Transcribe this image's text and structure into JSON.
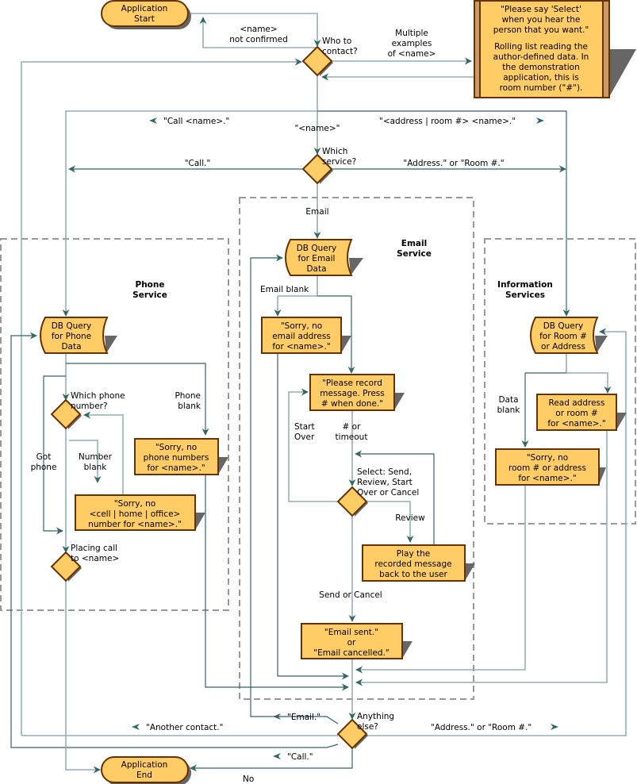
{
  "colors": {
    "node_fill": "#ffcc66",
    "node_border": "#663300",
    "connector": "#93b0b0",
    "arrow": "#336666",
    "shadow": "#666666",
    "region_border": "#999999"
  },
  "regions": {
    "phone": [
      "Phone",
      "Service"
    ],
    "email": [
      "Email",
      "Service"
    ],
    "info": [
      "Information",
      "Services"
    ]
  },
  "nodes": {
    "start": [
      "Application",
      "Start"
    ],
    "end": [
      "Application",
      "End"
    ],
    "who": [
      "Who to",
      "contact?"
    ],
    "prompt": [
      "\"Please say 'Select'",
      "when you hear the",
      "person that you want.\"",
      "Rolling list reading the",
      "author-defined data. In",
      "the demonstration",
      "application, this is",
      "room number (\"#\")."
    ],
    "which_service": [
      "Which",
      "service?"
    ],
    "db_email": [
      "DB Query",
      "for Email",
      "Data"
    ],
    "db_phone": [
      "DB Query",
      "for Phone",
      "Data"
    ],
    "db_room": [
      "DB Query",
      "for Room #",
      "or Address"
    ],
    "no_email": [
      "\"Sorry, no",
      "email address",
      "for <name>.\""
    ],
    "record": [
      "\"Please record",
      "message. Press",
      "# when done.\""
    ],
    "select": [
      "Select: Send,",
      "Review, Start",
      "Over or Cancel"
    ],
    "play": [
      "Play the",
      "recorded message",
      "back to the user"
    ],
    "sent": [
      "\"Email sent.\"",
      "or",
      "\"Email cancelled.\""
    ],
    "anything": [
      "Anything",
      "else?"
    ],
    "which_phone": [
      "Which phone",
      "number?"
    ],
    "no_phones": [
      "\"Sorry, no",
      "phone numbers",
      "for <name>.\""
    ],
    "no_number": [
      "\"Sorry, no",
      "<cell | home | office>",
      "number for <name>.\""
    ],
    "placing": [
      "Placing call",
      "to <name>"
    ],
    "read_addr": [
      "Read address",
      "or room #",
      "for <name>.\""
    ],
    "no_room": [
      "\"Sorry, no",
      "room # or address",
      "for <name>.\""
    ]
  },
  "labels": {
    "not_confirmed": [
      "<name>",
      "not confirmed"
    ],
    "multiple": [
      "Multiple",
      "examples",
      "of <name>"
    ],
    "call_name": "\"Call <name>.\"",
    "name": "\"<name>\"",
    "addr_name": "\"<address | room #> <name>.\"",
    "call": "\"Call.\"",
    "addr_room": "\"Address.\" or \"Room #.\"",
    "email": "Email",
    "email_blank": "Email blank",
    "phone_blank": [
      "Phone",
      "blank"
    ],
    "got_phone": [
      "Got",
      "phone"
    ],
    "number_blank": [
      "Number",
      "blank"
    ],
    "start_over": [
      "Start",
      "Over"
    ],
    "hash_timeout": [
      "# or",
      "timeout"
    ],
    "review": "Review",
    "send_cancel": "Send or Cancel",
    "data_blank": [
      "Data",
      "blank"
    ],
    "email_loop": "\"Email.\"",
    "another": "\"Another contact.\"",
    "addr_room2": "\"Address.\" or \"Room #.\"",
    "call_loop": "\"Call.\"",
    "no": "No"
  }
}
